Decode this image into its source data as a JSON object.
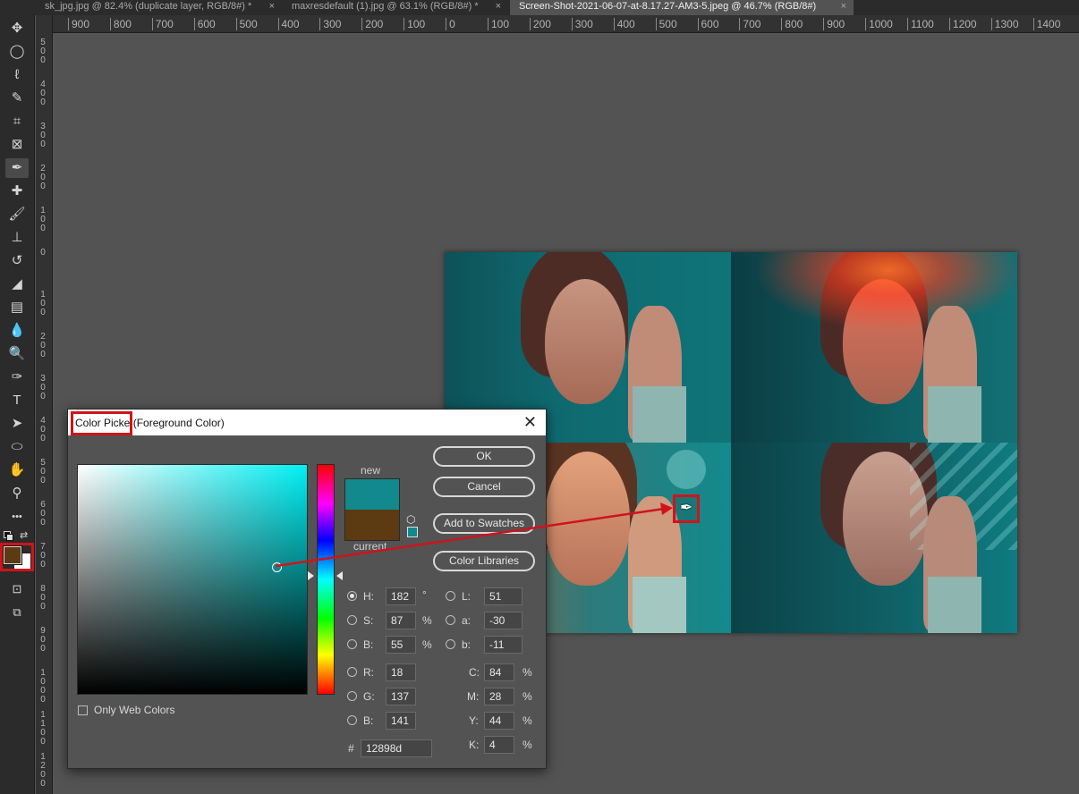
{
  "tabs": [
    {
      "label": "sk_jpg.jpg @ 82.4% (duplicate layer, RGB/8#) *",
      "close": "×"
    },
    {
      "label": "maxresdefault (1).jpg @ 63.1% (RGB/8#) *",
      "close": "×"
    },
    {
      "label": "Screen-Shot-2021-06-07-at-8.17.27-AM3-5.jpeg @ 46.7% (RGB/8#)",
      "close": "×"
    }
  ],
  "ruler": {
    "h_labels": [
      "900",
      "800",
      "700",
      "600",
      "500",
      "400",
      "300",
      "200",
      "100",
      "0",
      "100",
      "200",
      "300",
      "400",
      "500",
      "600",
      "700",
      "800",
      "900",
      "1000",
      "1100",
      "1200",
      "1300",
      "1400"
    ],
    "v_labels": [
      "500",
      "400",
      "300",
      "200",
      "100",
      "0",
      "100",
      "200",
      "300",
      "400",
      "500",
      "600",
      "700",
      "800",
      "900",
      "1000",
      "1100",
      "1200"
    ]
  },
  "tools": [
    {
      "icon": "move-icon",
      "glyph": "✥"
    },
    {
      "icon": "marquee-icon",
      "glyph": "◯"
    },
    {
      "icon": "lasso-icon",
      "glyph": "ℓ"
    },
    {
      "icon": "quick-selection-icon",
      "glyph": "✎"
    },
    {
      "icon": "crop-icon",
      "glyph": "⌗"
    },
    {
      "icon": "frame-icon",
      "glyph": "⊠"
    },
    {
      "icon": "eyedropper-icon",
      "glyph": "✒"
    },
    {
      "icon": "healing-brush-icon",
      "glyph": "✚"
    },
    {
      "icon": "brush-icon",
      "glyph": "🖌"
    },
    {
      "icon": "clone-stamp-icon",
      "glyph": "⊥"
    },
    {
      "icon": "history-brush-icon",
      "glyph": "↺"
    },
    {
      "icon": "eraser-icon",
      "glyph": "◢"
    },
    {
      "icon": "gradient-icon",
      "glyph": "▤"
    },
    {
      "icon": "blur-icon",
      "glyph": "💧"
    },
    {
      "icon": "dodge-icon",
      "glyph": "🔍"
    },
    {
      "icon": "pen-icon",
      "glyph": "✑"
    },
    {
      "icon": "type-icon",
      "glyph": "T"
    },
    {
      "icon": "path-selection-icon",
      "glyph": "➤"
    },
    {
      "icon": "ellipse-icon",
      "glyph": "⬭"
    },
    {
      "icon": "hand-icon",
      "glyph": "✋"
    },
    {
      "icon": "zoom-icon",
      "glyph": "⚲"
    },
    {
      "icon": "more-tools-icon",
      "glyph": "•••"
    }
  ],
  "colors": {
    "foreground": "#5c3a12",
    "background": "#ffffff",
    "new": "#12898d",
    "current": "#5c3a12",
    "highlight": "#d0131b"
  },
  "dialog": {
    "title_main": "Color Picke",
    "title_suffix": "(Foreground Color)",
    "close": "✕",
    "new_label": "new",
    "current_label": "current",
    "buttons": {
      "ok": "OK",
      "cancel": "Cancel",
      "add_swatches": "Add to Swatches",
      "color_libraries": "Color Libraries"
    },
    "only_web_colors": "Only Web Colors",
    "hsb": [
      {
        "label": "H:",
        "value": "182",
        "unit": "°",
        "selected": true
      },
      {
        "label": "S:",
        "value": "87",
        "unit": "%",
        "selected": false
      },
      {
        "label": "B:",
        "value": "55",
        "unit": "%",
        "selected": false
      }
    ],
    "rgb": [
      {
        "label": "R:",
        "value": "18"
      },
      {
        "label": "G:",
        "value": "137"
      },
      {
        "label": "B:",
        "value": "141"
      }
    ],
    "lab": [
      {
        "label": "L:",
        "value": "51"
      },
      {
        "label": "a:",
        "value": "-30"
      },
      {
        "label": "b:",
        "value": "-11"
      }
    ],
    "cmyk": [
      {
        "label": "C:",
        "value": "84",
        "unit": "%"
      },
      {
        "label": "M:",
        "value": "28",
        "unit": "%"
      },
      {
        "label": "Y:",
        "value": "44",
        "unit": "%"
      },
      {
        "label": "K:",
        "value": "4",
        "unit": "%"
      }
    ],
    "hex_label": "#",
    "hex_value": "12898d"
  }
}
